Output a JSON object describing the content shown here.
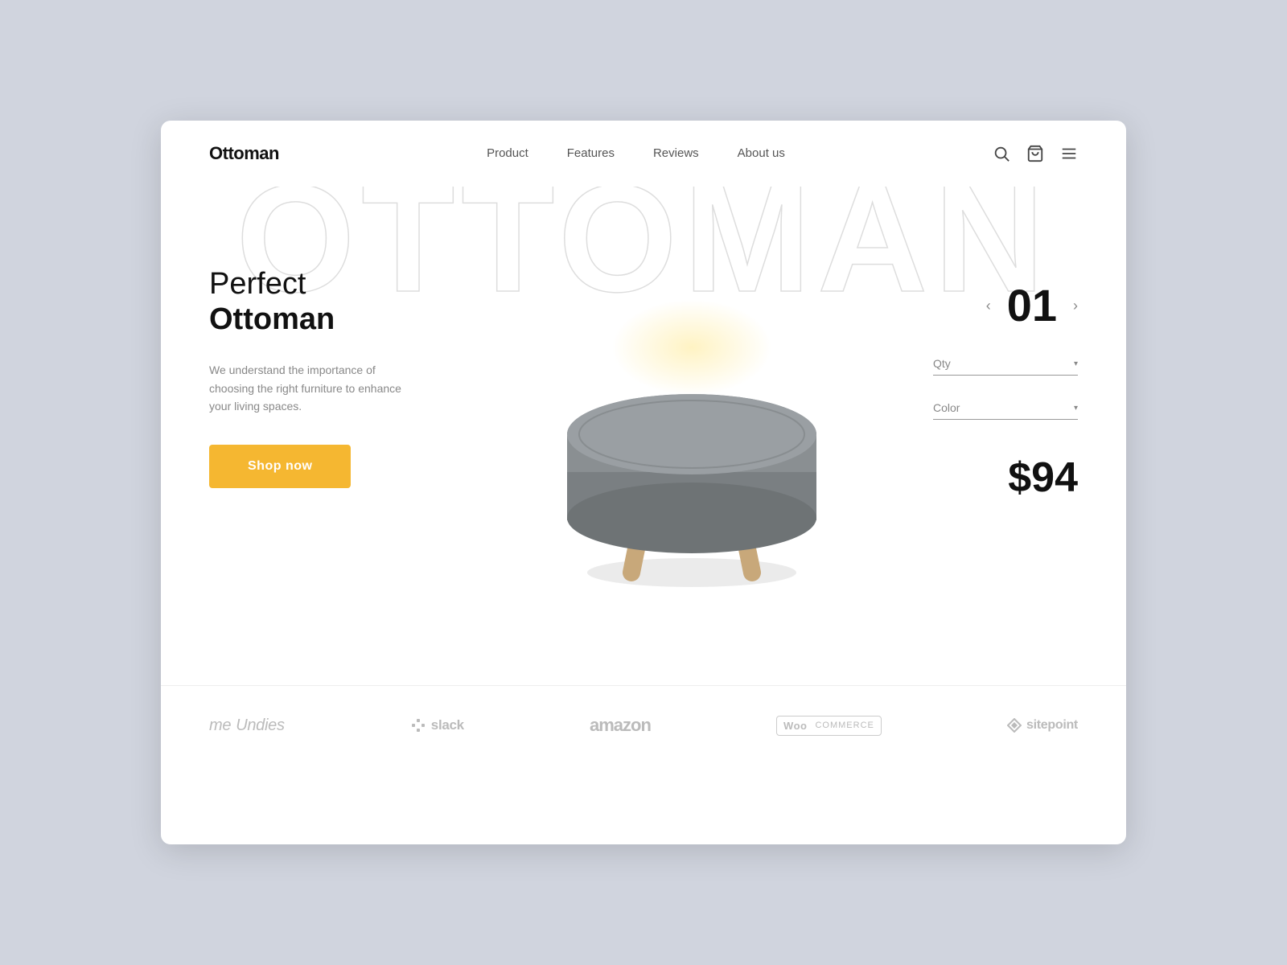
{
  "nav": {
    "logo": "Ottoman",
    "links": [
      {
        "id": "product",
        "label": "Product"
      },
      {
        "id": "features",
        "label": "Features"
      },
      {
        "id": "reviews",
        "label": "Reviews"
      },
      {
        "id": "about",
        "label": "About us"
      }
    ]
  },
  "hero": {
    "bg_text": "OTTOMAN",
    "subtitle": "Perfect",
    "title": "Ottoman",
    "description": "We understand the importance of choosing the right furniture to enhance your living spaces.",
    "shop_button": "Shop now",
    "counter": "01",
    "qty_label": "Qty",
    "color_label": "Color",
    "price": "$94"
  },
  "partners": [
    {
      "id": "meundies",
      "name": "MeUndies",
      "icon": ""
    },
    {
      "id": "slack",
      "name": "slack",
      "icon": "✦"
    },
    {
      "id": "amazon",
      "name": "amazon",
      "icon": ""
    },
    {
      "id": "woocommerce",
      "name": "WooCommerce",
      "icon": "Woo"
    },
    {
      "id": "sitepoint",
      "name": "sitepoint",
      "icon": "◈"
    }
  ],
  "colors": {
    "accent": "#f5b731",
    "bg_outline": "#ddd",
    "text_dark": "#111",
    "text_muted": "#888"
  }
}
